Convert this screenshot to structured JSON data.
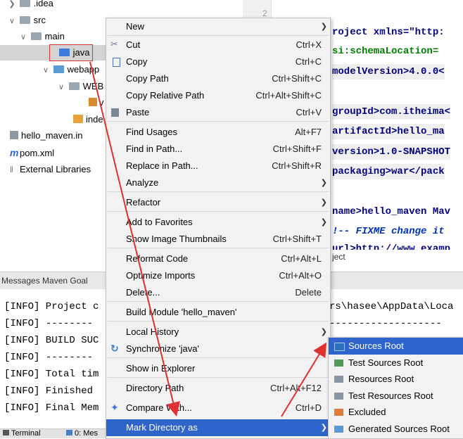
{
  "tree": {
    "items": [
      {
        "label": ".idea"
      },
      {
        "label": "src"
      },
      {
        "label": "main"
      },
      {
        "label": "java"
      },
      {
        "label": "webapp"
      },
      {
        "label": "WEB"
      },
      {
        "label": "v"
      },
      {
        "label": "inde"
      },
      {
        "label": "hello_maven.in"
      },
      {
        "label": "pom.xml"
      },
      {
        "label": "External Libraries"
      }
    ]
  },
  "gutter": {
    "line_number": "2"
  },
  "editor": {
    "lines": [
      {
        "text": "roject xmlns=\"http:"
      },
      {
        "text": "si:schemaLocation="
      },
      {
        "text": "modelVersion>4.0.0<"
      },
      {
        "text": "groupId>com.itheima<"
      },
      {
        "text": "artifactId>hello_ma"
      },
      {
        "text": "version>1.0-SNAPSHOT"
      },
      {
        "text": "packaging>war</pack"
      },
      {
        "text": "name>hello_maven Mav"
      },
      {
        "text": "!-- FIXME change it"
      },
      {
        "text": "url>http://www.examp"
      },
      {
        "text": "ject"
      }
    ]
  },
  "messages": {
    "header": "Messages Maven Goal",
    "lines": [
      "[INFO] Project c",
      "[INFO] --------",
      "[INFO] BUILD SUC",
      "[INFO] --------",
      "[INFO] Total tim",
      "[INFO] Finished",
      "[INFO] Final Mem"
    ],
    "right_text": "rs\\hasee\\AppData\\Loca",
    "right_dashes": "-------------------"
  },
  "bottombar": {
    "terminal": "Terminal",
    "messages": "0: Mes"
  },
  "menu": {
    "items": [
      {
        "label": "New",
        "shortcut": "",
        "sub": true
      },
      {
        "label": "Cut",
        "shortcut": "Ctrl+X",
        "icon": "scissors-icon"
      },
      {
        "label": "Copy",
        "shortcut": "Ctrl+C",
        "icon": "copy-icon"
      },
      {
        "label": "Copy Path",
        "shortcut": "Ctrl+Shift+C"
      },
      {
        "label": "Copy Relative Path",
        "shortcut": "Ctrl+Alt+Shift+C"
      },
      {
        "label": "Paste",
        "shortcut": "Ctrl+V",
        "icon": "paste-icon"
      },
      {
        "label": "Find Usages",
        "shortcut": "Alt+F7"
      },
      {
        "label": "Find in Path...",
        "shortcut": "Ctrl+Shift+F"
      },
      {
        "label": "Replace in Path...",
        "shortcut": "Ctrl+Shift+R"
      },
      {
        "label": "Analyze",
        "shortcut": "",
        "sub": true
      },
      {
        "label": "Refactor",
        "shortcut": "",
        "sub": true
      },
      {
        "label": "Add to Favorites",
        "shortcut": "",
        "sub": true
      },
      {
        "label": "Show Image Thumbnails",
        "shortcut": "Ctrl+Shift+T"
      },
      {
        "label": "Reformat Code",
        "shortcut": "Ctrl+Alt+L"
      },
      {
        "label": "Optimize Imports",
        "shortcut": "Ctrl+Alt+O"
      },
      {
        "label": "Delete...",
        "shortcut": "Delete"
      },
      {
        "label": "Build Module 'hello_maven'",
        "shortcut": ""
      },
      {
        "label": "Local History",
        "shortcut": "",
        "sub": true
      },
      {
        "label": "Synchronize 'java'",
        "shortcut": "",
        "icon": "sync-icon"
      },
      {
        "label": "Show in Explorer",
        "shortcut": ""
      },
      {
        "label": "Directory Path",
        "shortcut": "Ctrl+Alt+F12"
      },
      {
        "label": "Compare With...",
        "shortcut": "Ctrl+D",
        "icon": "compare-icon"
      },
      {
        "label": "Mark Directory as",
        "shortcut": "",
        "sub": true,
        "active": true
      }
    ]
  },
  "submenu": {
    "items": [
      {
        "label": "Sources Root",
        "color": "#2f6fbf",
        "active": true
      },
      {
        "label": "Test Sources Root",
        "color": "#4f9a55"
      },
      {
        "label": "Resources Root",
        "color": "#8a95a5"
      },
      {
        "label": "Test Resources Root",
        "color": "#8a95a5"
      },
      {
        "label": "Excluded",
        "color": "#e07b39"
      },
      {
        "label": "Generated Sources Root",
        "color": "#5a9bd4"
      }
    ]
  },
  "colors": {
    "accent": "#2f65ca",
    "annotation": "#e03030"
  }
}
